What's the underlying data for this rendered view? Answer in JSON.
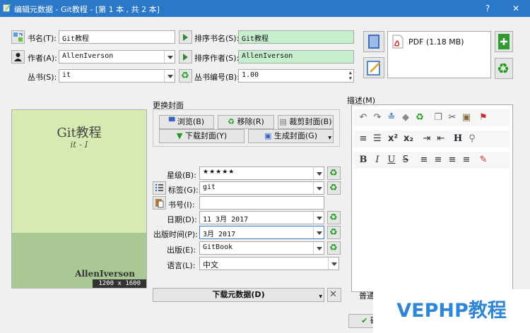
{
  "window": {
    "title": "编辑元数据 - Git教程 - [第 1 本 , 共 2 本]",
    "help_label": "?",
    "close_label": "✕"
  },
  "title_row": {
    "label": "书名(T):",
    "value": "Git教程",
    "sort_label": "排序书名(S):",
    "sort_value": "Git教程"
  },
  "author_row": {
    "label": "作者(A):",
    "value": "AllenIverson",
    "sort_label": "排序作者(S):",
    "sort_value": "AllenIverson"
  },
  "series_row": {
    "label": "丛书(S):",
    "value": "it",
    "number_label": "丛书编号(B):",
    "number_value": "1.00"
  },
  "format": {
    "label": "PDF (1.18 MB)"
  },
  "cover_section": {
    "title": "更换封面",
    "browse_label": "浏览(B)",
    "remove_label": "移除(R)",
    "trim_label": "裁剪封面(B)",
    "download_label": "下载封面(Y)",
    "generate_label": "生成封面(G)"
  },
  "cover": {
    "title": "Git教程",
    "series": "it - I",
    "author": "AllenIverson",
    "size": "1200 x 1600"
  },
  "fields": {
    "rating": {
      "label": "星级(B):",
      "value": "★★★★★"
    },
    "tags": {
      "label": "标签(G):",
      "value": "git"
    },
    "isbn": {
      "label": "书号(I):",
      "value": ""
    },
    "date": {
      "label": "日期(D):",
      "value": "11 3月 2017"
    },
    "pubdate": {
      "label": "出版时间(P):",
      "value": "3月 2017"
    },
    "publisher": {
      "label": "出版(E):",
      "value": "GitBook"
    },
    "language": {
      "label": "语言(L):",
      "value": "中文"
    }
  },
  "download_metadata_label": "下载元数据(D)",
  "comments": {
    "label": "描述(M)",
    "mode_label": "普通"
  },
  "ok_label": "确"
}
